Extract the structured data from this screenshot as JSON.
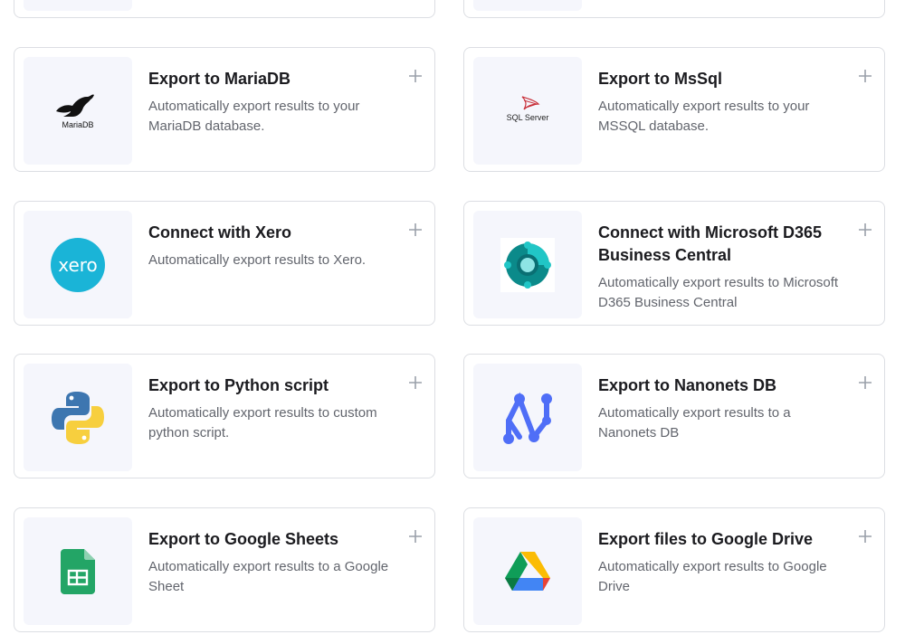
{
  "cards": [
    {
      "title": "Export to MariaDB",
      "description": "Automatically export results to your MariaDB database.",
      "icon": "mariadb-logo-icon"
    },
    {
      "title": "Export to MsSql",
      "description": "Automatically export results to your MSSQL database.",
      "icon": "sql-server-logo-icon"
    },
    {
      "title": "Connect with Xero",
      "description": "Automatically export results to Xero.",
      "icon": "xero-logo-icon"
    },
    {
      "title": "Connect with Microsoft D365 Business Central",
      "description": "Automatically export results to Microsoft D365 Business Central",
      "icon": "d365-business-central-logo-icon"
    },
    {
      "title": "Export to Python script",
      "description": "Automatically export results to custom python script.",
      "icon": "python-logo-icon"
    },
    {
      "title": "Export to Nanonets DB",
      "description": "Automatically export results to a Nanonets DB",
      "icon": "nanonets-db-logo-icon"
    },
    {
      "title": "Export to Google Sheets",
      "description": "Automatically export results to a Google Sheet",
      "icon": "google-sheets-logo-icon"
    },
    {
      "title": "Export files to Google Drive",
      "description": "Automatically export results to Google Drive",
      "icon": "google-drive-logo-icon"
    }
  ],
  "logos": {
    "mariadb_text": "MariaDB",
    "sqlserver_text": "SQL Server",
    "xero_text": "xero"
  },
  "colors": {
    "card_border": "#dcdee3",
    "tile_bg": "#f5f6fc",
    "title": "#1b1b1f",
    "description": "#62656d",
    "plus": "#9aa0aa",
    "xero": "#1ab4d7",
    "nanonets": "#4f6ef7"
  }
}
